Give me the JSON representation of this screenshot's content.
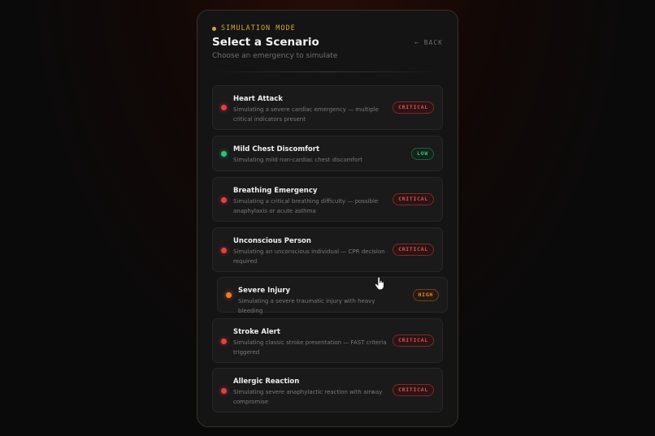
{
  "header": {
    "eyebrow": "SIMULATION MODE",
    "title": "Select a Scenario",
    "subtitle": "Choose an emergency to simulate",
    "back_label": "← BACK"
  },
  "colors": {
    "accent": "#d4a53a",
    "critical": "#e2403f",
    "low": "#2fc27a",
    "high": "#ef7a26"
  },
  "scenarios": [
    {
      "name": "Heart Attack",
      "description": "Simulating a severe cardiac emergency — multiple critical indicators present",
      "severity": "CRITICAL"
    },
    {
      "name": "Mild Chest Discomfort",
      "description": "Simulating mild non-cardiac chest discomfort",
      "severity": "LOW"
    },
    {
      "name": "Breathing Emergency",
      "description": "Simulating a critical breathing difficulty — possible anaphylaxis or acute asthma",
      "severity": "CRITICAL"
    },
    {
      "name": "Unconscious Person",
      "description": "Simulating an unconscious individual — CPR decision required",
      "severity": "CRITICAL"
    },
    {
      "name": "Severe Injury",
      "description": "Simulating a severe traumatic injury with heavy bleeding",
      "severity": "HIGH"
    },
    {
      "name": "Stroke Alert",
      "description": "Simulating classic stroke presentation — FAST criteria triggered",
      "severity": "CRITICAL"
    },
    {
      "name": "Allergic Reaction",
      "description": "Simulating severe anaphylactic reaction with airway compromise",
      "severity": "CRITICAL"
    }
  ]
}
